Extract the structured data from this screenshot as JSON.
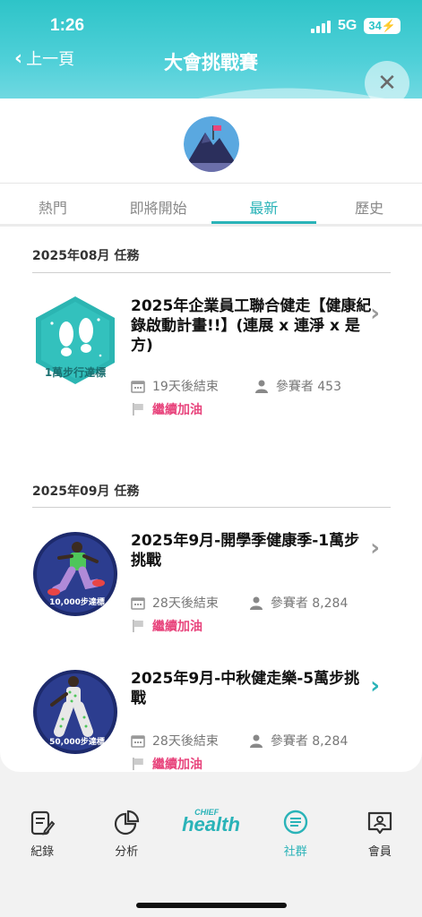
{
  "status_bar": {
    "time": "1:26",
    "network": "5G",
    "battery": "34"
  },
  "header": {
    "back_label": "上一頁",
    "title": "大會挑戰賽"
  },
  "tabs": [
    {
      "label": "熱門"
    },
    {
      "label": "即將開始"
    },
    {
      "label": "最新"
    },
    {
      "label": "歷史"
    }
  ],
  "active_tab": "最新",
  "sections": [
    {
      "title": "2025年08月 任務",
      "challenges": [
        {
          "title": "2025年企業員工聯合健走【健康紀錄啟動計畫!!】(連展 x 連淨 x 是方)",
          "badge_label": "1萬步行達標",
          "ends": "19天後結束",
          "participants": "參賽者 453",
          "status": "繼續加油"
        }
      ]
    },
    {
      "title": "2025年09月 任務",
      "challenges": [
        {
          "title": "2025年9月-開學季健康季-1萬步挑戰",
          "badge_label": "10,000步達標",
          "ends": "28天後結束",
          "participants": "參賽者 8,284",
          "status": "繼續加油"
        },
        {
          "title": "2025年9月-中秋健走樂-5萬步挑戰",
          "badge_label": "50,000步達標",
          "ends": "28天後結束",
          "participants": "參賽者 8,284",
          "status": "繼續加油"
        }
      ]
    }
  ],
  "bottom_nav": [
    {
      "label": "紀錄",
      "icon": "record-icon"
    },
    {
      "label": "分析",
      "icon": "analysis-icon"
    },
    {
      "label": "",
      "icon": "chief-health-logo"
    },
    {
      "label": "社群",
      "icon": "community-icon"
    },
    {
      "label": "會員",
      "icon": "member-icon"
    }
  ],
  "logo": {
    "top": "CHIEF",
    "main": "health"
  },
  "colors": {
    "accent": "#2ab3b8",
    "encourage": "#e8457d",
    "header_teal": "#2ec4c8"
  }
}
